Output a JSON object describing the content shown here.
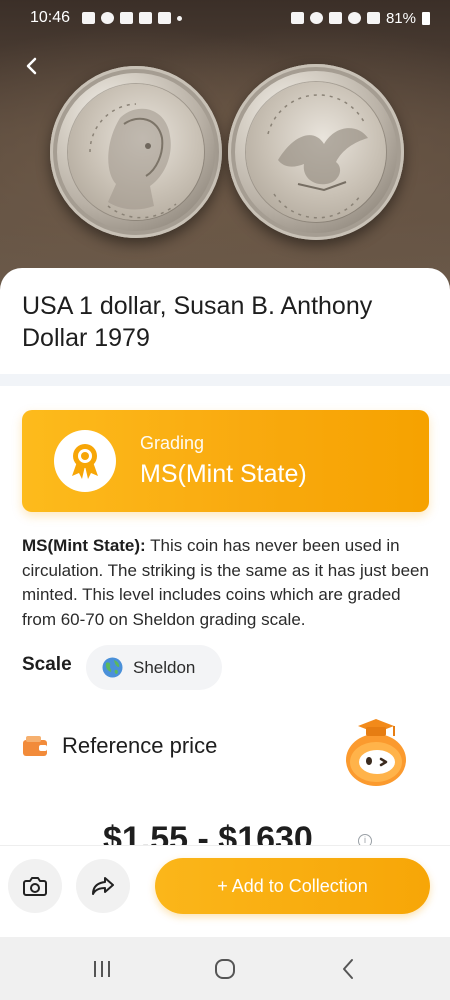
{
  "status_bar": {
    "time": "10:46",
    "battery": "81%"
  },
  "coin": {
    "title": "USA 1 dollar, Susan B. Anthony Dollar 1979"
  },
  "grading": {
    "label": "Grading",
    "value": "MS(Mint State)",
    "icon": "medal-icon"
  },
  "description": {
    "term": "MS(Mint State):",
    "text": " This coin has never been used in circulation. The striking is the same as it has just been minted. This level includes coins which are graded from 60-70 on Sheldon grading scale."
  },
  "scale": {
    "label": "Scale",
    "value": "Sheldon"
  },
  "reference_price": {
    "label": "Reference price",
    "range": "$1.55 - $1630"
  },
  "actions": {
    "add_to_collection": "+ Add to Collection",
    "camera_icon": "camera-icon",
    "share_icon": "share-icon"
  },
  "colors": {
    "accent": "#f9aa0f",
    "accent_light": "#fdbb1c",
    "card_bg": "#ffffff",
    "separator": "#f1f4f8"
  }
}
